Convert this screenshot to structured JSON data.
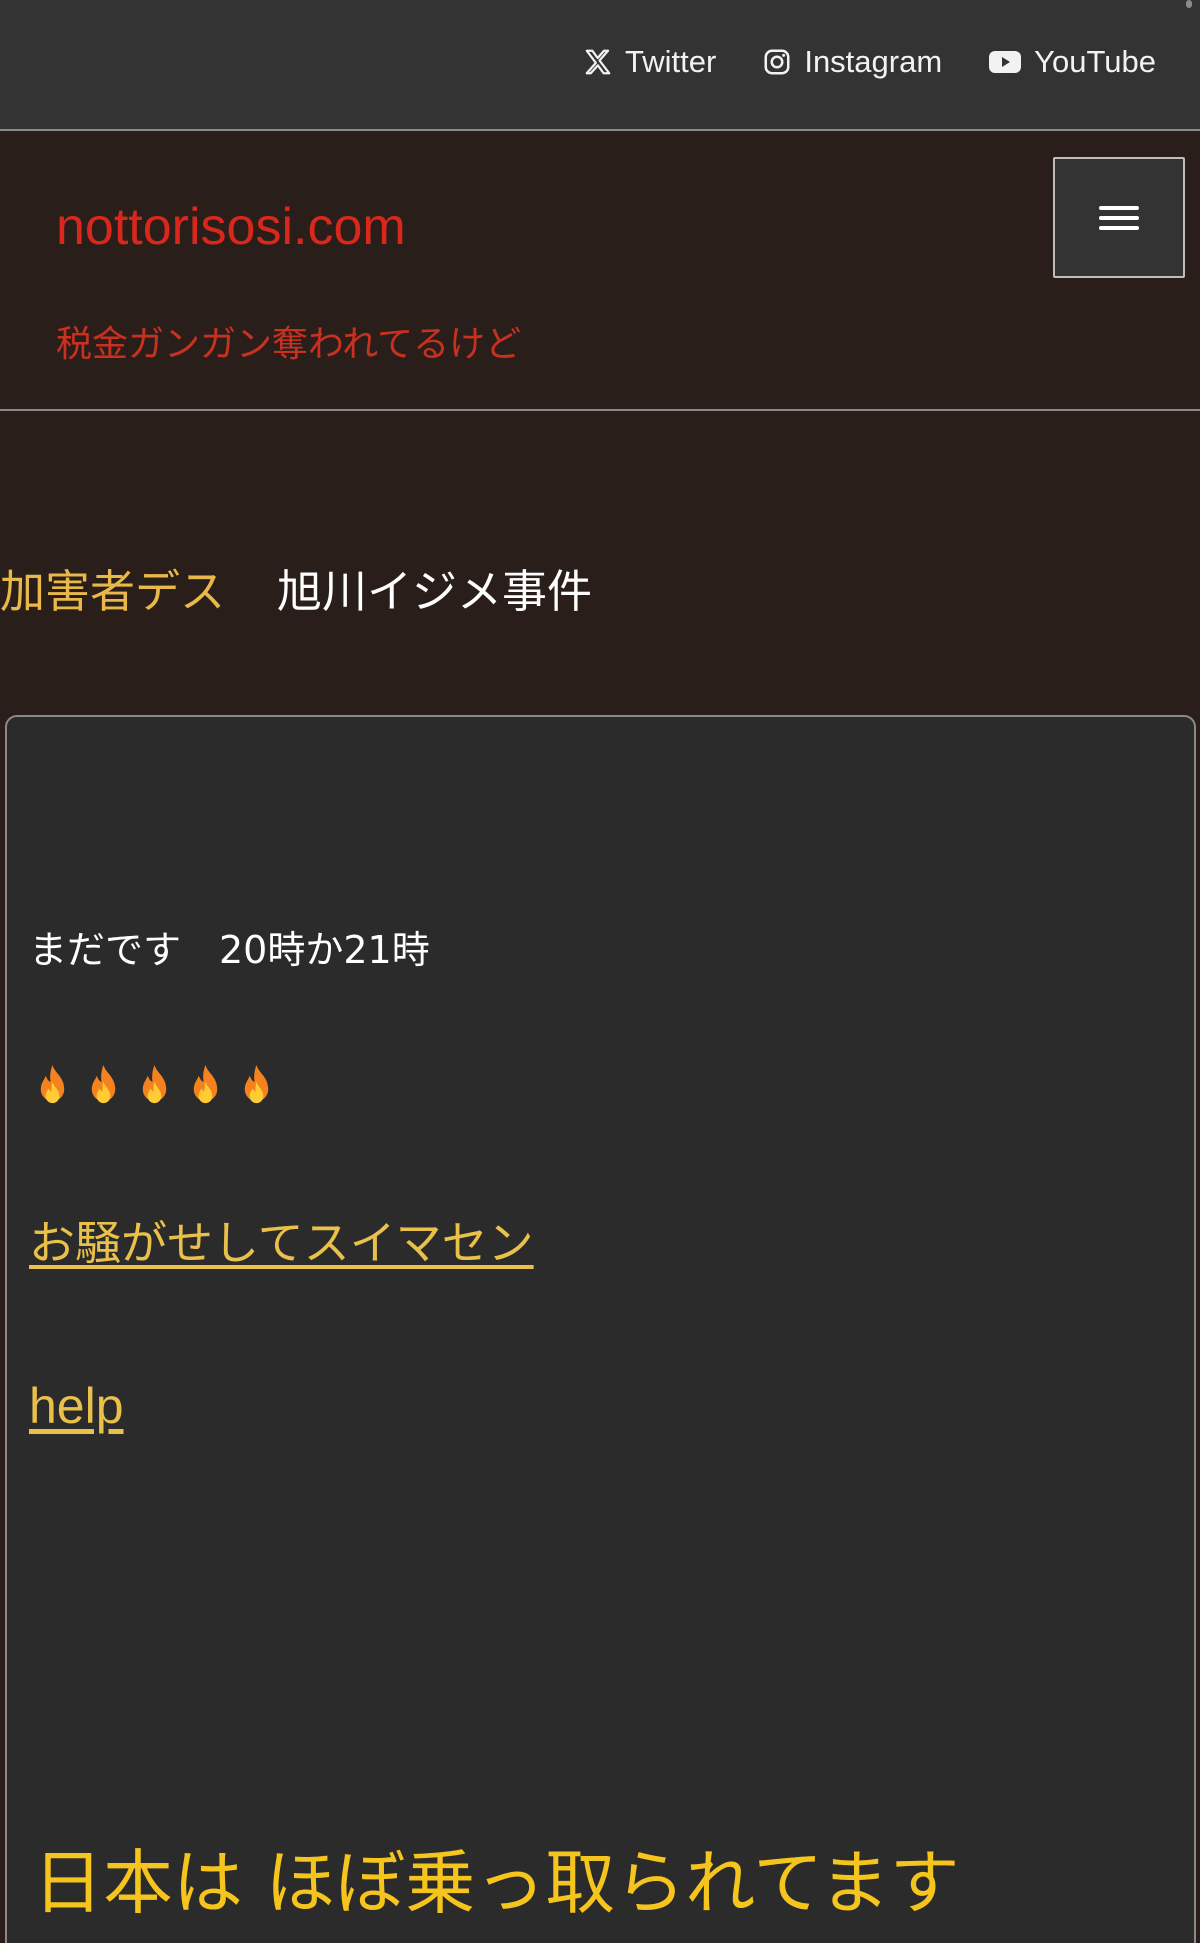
{
  "topbar": {
    "links": [
      {
        "label": "Twitter",
        "icon": "x-twitter-icon"
      },
      {
        "label": "Instagram",
        "icon": "instagram-icon"
      },
      {
        "label": "YouTube",
        "icon": "youtube-icon"
      }
    ]
  },
  "header": {
    "site_title": "nottorisosi.com",
    "tagline": "税金ガンガン奪われてるけど",
    "menu_icon": "hamburger-menu-icon"
  },
  "post": {
    "category": "加害者デス",
    "title": "旭川イジメ事件"
  },
  "content": {
    "line1": "まだです　20時か21時",
    "fire_count": 5,
    "link1": "お騒がせしてスイマセン",
    "link2": "help",
    "big_text": "日本は ほぼ乗っ取られてます"
  },
  "colors": {
    "background": "#2a1e1b",
    "topbar": "#333333",
    "site_title": "#d9281b",
    "category": "#e8b84a",
    "link": "#e8c04a",
    "big_text": "#f5c51e"
  }
}
